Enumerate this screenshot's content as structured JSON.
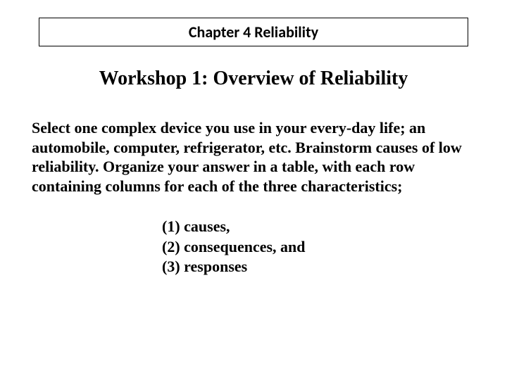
{
  "header": {
    "chapter_title": "Chapter 4 Reliability"
  },
  "title": "Workshop 1: Overview of Reliability",
  "body": "Select one complex device you use in your every-day life; an automobile, computer, refrigerator, etc.  Brainstorm causes of low reliability. Organize your answer in a table, with each row containing columns for each of the three characteristics;",
  "list": {
    "item1": "(1) causes,",
    "item2": "(2) consequences, and",
    "item3": "(3) responses"
  }
}
